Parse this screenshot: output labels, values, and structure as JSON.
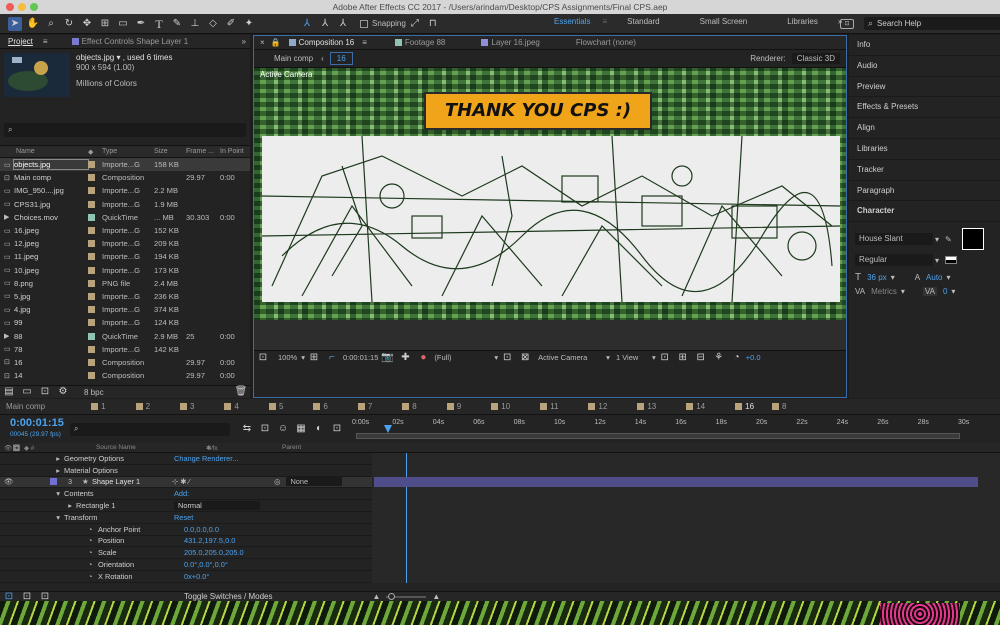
{
  "app_title": "Adobe After Effects CC 2017 - /Users/arindam/Desktop/CPS Assignments/Final CPS.aep",
  "toolbar": {
    "snapping_label": "Snapping",
    "workspaces": [
      "Essentials",
      "Standard",
      "Small Screen",
      "Libraries"
    ],
    "active_workspace": "Essentials",
    "search_help_placeholder": "Search Help"
  },
  "project_panel": {
    "tab_project": "Project",
    "tab_effect_controls": "Effect Controls Shape Layer 1",
    "selected_name": "objects.jpg ▾ , used 6 times",
    "selected_dims": "900 x 594 (1.00)",
    "selected_colors": "Millions of Colors",
    "search_placeholder": "",
    "columns": [
      "Name",
      "Type",
      "Size",
      "Frame ...",
      "In Point"
    ],
    "bpc_label": "8 bpc",
    "items": [
      {
        "name": "objects.jpg",
        "type": "Importe...G",
        "size": "158 KB",
        "frame": "",
        "inpoint": "",
        "color": "#b9a37a",
        "icon": "image-icon"
      },
      {
        "name": "Main comp",
        "type": "Composition",
        "size": "",
        "frame": "29.97",
        "inpoint": "0:00",
        "color": "#b9a37a",
        "icon": "composition-icon"
      },
      {
        "name": "IMG_950....jpg",
        "type": "Importe...G",
        "size": "2.2 MB",
        "frame": "",
        "inpoint": "",
        "color": "#b9a37a",
        "icon": "image-icon"
      },
      {
        "name": "CPS31.jpg",
        "type": "Importe...G",
        "size": "1.9 MB",
        "frame": "",
        "inpoint": "",
        "color": "#b9a37a",
        "icon": "image-icon"
      },
      {
        "name": "Choices.mov",
        "type": "QuickTime",
        "size": "... MB",
        "frame": "30.303",
        "inpoint": "0:00",
        "color": "#8fc3b2",
        "icon": "movie-icon"
      },
      {
        "name": "16.jpeg",
        "type": "Importe...G",
        "size": "152 KB",
        "frame": "",
        "inpoint": "",
        "color": "#b9a37a",
        "icon": "image-icon"
      },
      {
        "name": "12.jpeg",
        "type": "Importe...G",
        "size": "209 KB",
        "frame": "",
        "inpoint": "",
        "color": "#b9a37a",
        "icon": "image-icon"
      },
      {
        "name": "11.jpeg",
        "type": "Importe...G",
        "size": "194 KB",
        "frame": "",
        "inpoint": "",
        "color": "#b9a37a",
        "icon": "image-icon"
      },
      {
        "name": "10.jpeg",
        "type": "Importe...G",
        "size": "173 KB",
        "frame": "",
        "inpoint": "",
        "color": "#b9a37a",
        "icon": "image-icon"
      },
      {
        "name": "8.png",
        "type": "PNG file",
        "size": "2.4 MB",
        "frame": "",
        "inpoint": "",
        "color": "#b9a37a",
        "icon": "image-icon"
      },
      {
        "name": "5.jpg",
        "type": "Importe...G",
        "size": "236 KB",
        "frame": "",
        "inpoint": "",
        "color": "#b9a37a",
        "icon": "image-icon"
      },
      {
        "name": "4.jpg",
        "type": "Importe...G",
        "size": "374 KB",
        "frame": "",
        "inpoint": "",
        "color": "#b9a37a",
        "icon": "image-icon"
      },
      {
        "name": "99",
        "type": "Importe...G",
        "size": "124 KB",
        "frame": "",
        "inpoint": "",
        "color": "#b9a37a",
        "icon": "image-icon"
      },
      {
        "name": "88",
        "type": "QuickTime",
        "size": "2.9 MB",
        "frame": "25",
        "inpoint": "0:00",
        "color": "#8fc3b2",
        "icon": "movie-icon"
      },
      {
        "name": "78",
        "type": "Importe...G",
        "size": "142 KB",
        "frame": "",
        "inpoint": "",
        "color": "#b9a37a",
        "icon": "image-icon"
      },
      {
        "name": "16",
        "type": "Composition",
        "size": "",
        "frame": "29.97",
        "inpoint": "0:00",
        "color": "#b9a37a",
        "icon": "composition-icon"
      },
      {
        "name": "14",
        "type": "Composition",
        "size": "",
        "frame": "29.97",
        "inpoint": "0:00",
        "color": "#b9a37a",
        "icon": "composition-icon"
      }
    ]
  },
  "comp_panel": {
    "tabs": [
      {
        "label": "Composition 16",
        "color": "#8fa9c9"
      },
      {
        "label": "Footage 88",
        "color": "#8fc3b2"
      },
      {
        "label": "Layer 16.jpeg",
        "color": "#8f8fd9"
      },
      {
        "label": "Flowchart (none)",
        "color": ""
      }
    ],
    "breadcrumb_main": "Main comp",
    "breadcrumb_sub": "16",
    "renderer_label": "Renderer:",
    "renderer_value": "Classic 3D",
    "viewer_label": "Active Camera",
    "banner_text": "THANK YOU  CPS :)",
    "footer": {
      "zoom": "100%",
      "timecode": "0:00:01:15",
      "resolution": "(Full)",
      "view": "Active Camera",
      "views_count": "1 View",
      "exposure": "+0.0"
    }
  },
  "right_panel": {
    "items": [
      "Info",
      "Audio",
      "Preview",
      "Effects & Presets",
      "Align",
      "Libraries",
      "Tracker",
      "Paragraph",
      "Character"
    ],
    "font_name": "House Slant",
    "font_style": "Regular",
    "font_size": "36 px",
    "leading": "Auto",
    "kerning": "Metrics",
    "tracking": "0"
  },
  "timeline": {
    "tabs": [
      "Main comp",
      "1",
      "2",
      "3",
      "4",
      "5",
      "6",
      "7",
      "8",
      "9",
      "10",
      "11",
      "12",
      "13",
      "14",
      "16",
      "8"
    ],
    "tab_colors": [
      "#b9a37a",
      "#b9a37a",
      "#b9a37a",
      "#b9a37a",
      "#b9a37a",
      "#b9a37a",
      "#b9a37a",
      "#b9a37a",
      "#b9a37a",
      "#b9a37a",
      "#b9a37a",
      "#b9a37a",
      "#b9a37a",
      "#b9a37a",
      "#b9a37a",
      "#b9a37a",
      "#b9a37a"
    ],
    "active_tab": "16",
    "current_time": "0:00:01:15",
    "current_frame": "00045 (29.97 fps)",
    "col_source": "Source Name",
    "col_parent": "Parent",
    "ruler": [
      "0:00s",
      "02s",
      "04s",
      "06s",
      "08s",
      "10s",
      "12s",
      "14s",
      "16s",
      "18s",
      "20s",
      "22s",
      "24s",
      "26s",
      "28s",
      "30s"
    ],
    "rows": [
      {
        "indent": 60,
        "label": "Geometry Options",
        "value": "Change Renderer...",
        "twirl": "▸"
      },
      {
        "indent": 60,
        "label": "Material Options",
        "value": "",
        "twirl": "▸"
      },
      {
        "indent": 0,
        "label": "Shape Layer 1",
        "value": "",
        "twirl": "▾",
        "layer_num": "3",
        "parent": "None"
      },
      {
        "indent": 60,
        "label": "Contents",
        "value": "Add:",
        "twirl": "▾"
      },
      {
        "indent": 72,
        "label": "Rectangle 1",
        "value": "Normal",
        "twirl": "▸"
      },
      {
        "indent": 60,
        "label": "Transform",
        "value": "Reset",
        "twirl": "▾"
      },
      {
        "indent": 84,
        "label": "Anchor Point",
        "value": "0.0,0.0,0.0",
        "twirl": ""
      },
      {
        "indent": 84,
        "label": "Position",
        "value": "431.2,197.5,0.0",
        "twirl": ""
      },
      {
        "indent": 84,
        "label": "Scale",
        "value": "205.0,205.0,205.0",
        "twirl": ""
      },
      {
        "indent": 84,
        "label": "Orientation",
        "value": "0.0°,0.0°,0.0°",
        "twirl": ""
      },
      {
        "indent": 84,
        "label": "X Rotation",
        "value": "0x+0.0°",
        "twirl": ""
      }
    ],
    "toggle_label": "Toggle Switches / Modes"
  }
}
